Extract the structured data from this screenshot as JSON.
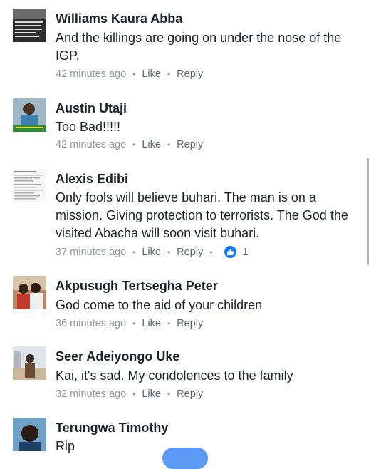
{
  "comments": [
    {
      "author": "Williams Kaura Abba",
      "text": "And the killings are going on under the nose of the IGP.",
      "time": "42 minutes ago",
      "like_label": "Like",
      "reply_label": "Reply"
    },
    {
      "author": "Austin Utaji",
      "text": "Too Bad!!!!!",
      "time": "42 minutes ago",
      "like_label": "Like",
      "reply_label": "Reply"
    },
    {
      "author": "Alexis Edibi",
      "text": "Only fools will believe buhari. The man is on a mission.  Giving protection to terrorists. The God the visited Abacha will soon visit buhari.",
      "time": "37 minutes ago",
      "like_label": "Like",
      "reply_label": "Reply",
      "reaction_count": "1"
    },
    {
      "author": "Akpusugh Tertsegha Peter",
      "text": "God come to the aid of your children",
      "time": "36 minutes ago",
      "like_label": "Like",
      "reply_label": "Reply"
    },
    {
      "author": "Seer Adeiyongo Uke",
      "text": "Kai, it's sad. My condolences to the family",
      "time": "32 minutes ago",
      "like_label": "Like",
      "reply_label": "Reply"
    },
    {
      "author": "Terungwa Timothy",
      "text": "Rip"
    }
  ],
  "colors": {
    "name": "#1d2129",
    "meta": "#90949c",
    "like_blue": "#1877f2"
  },
  "icons": {
    "reaction": "thumbs-up-icon"
  }
}
